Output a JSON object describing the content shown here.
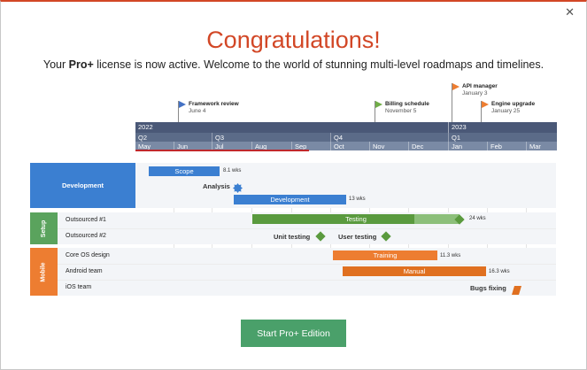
{
  "dialog": {
    "close_label": "✕",
    "title": "Congratulations!",
    "subtitle_prefix": "Your ",
    "subtitle_bold": "Pro+",
    "subtitle_rest": " license is now active. Welcome to the world of stunning multi-level roadmaps and timelines.",
    "button_label": "Start Pro+ Edition"
  },
  "milestones": [
    {
      "name": "Framework review",
      "date": "June 4",
      "color": "#4472c4"
    },
    {
      "name": "Billing schedule",
      "date": "November 5",
      "color": "#70ad47"
    },
    {
      "name": "API manager",
      "date": "January 3",
      "color": "#ed7d31"
    },
    {
      "name": "Engine upgrade",
      "date": "January 25",
      "color": "#ed7d31"
    }
  ],
  "timescale": {
    "years": [
      "2022",
      "2023"
    ],
    "quarters": [
      "Q2",
      "Q3",
      "Q4",
      "Q1"
    ],
    "months": [
      "May",
      "Jun",
      "Jul",
      "Aug",
      "Sep",
      "Oct",
      "Nov",
      "Dec",
      "Jan",
      "Feb",
      "Mar"
    ]
  },
  "swimlanes": {
    "development": {
      "label": "Development",
      "color": "#3b7fd1"
    },
    "setup": {
      "label": "Setup",
      "color": "#5aa35d",
      "rows": [
        "Outsourced #1",
        "Outsourced #2"
      ]
    },
    "mobile": {
      "label": "Mobile",
      "color": "#ed7d31",
      "rows": [
        "Core OS design",
        "Android team",
        "iOS team"
      ]
    }
  },
  "tasks": {
    "scope": {
      "label": "Scope",
      "duration": "8.1 wks"
    },
    "analysis": {
      "label": "Analysis"
    },
    "development": {
      "label": "Development",
      "duration": "13 wks"
    },
    "testing": {
      "label": "Testing",
      "duration": "24 wks",
      "progress": 0.78
    },
    "unit_testing": {
      "label": "Unit testing"
    },
    "user_testing": {
      "label": "User testing"
    },
    "training": {
      "label": "Training",
      "duration": "11.3 wks"
    },
    "manual": {
      "label": "Manual",
      "duration": "16.3 wks"
    },
    "bugs_fixing": {
      "label": "Bugs fixing"
    }
  }
}
